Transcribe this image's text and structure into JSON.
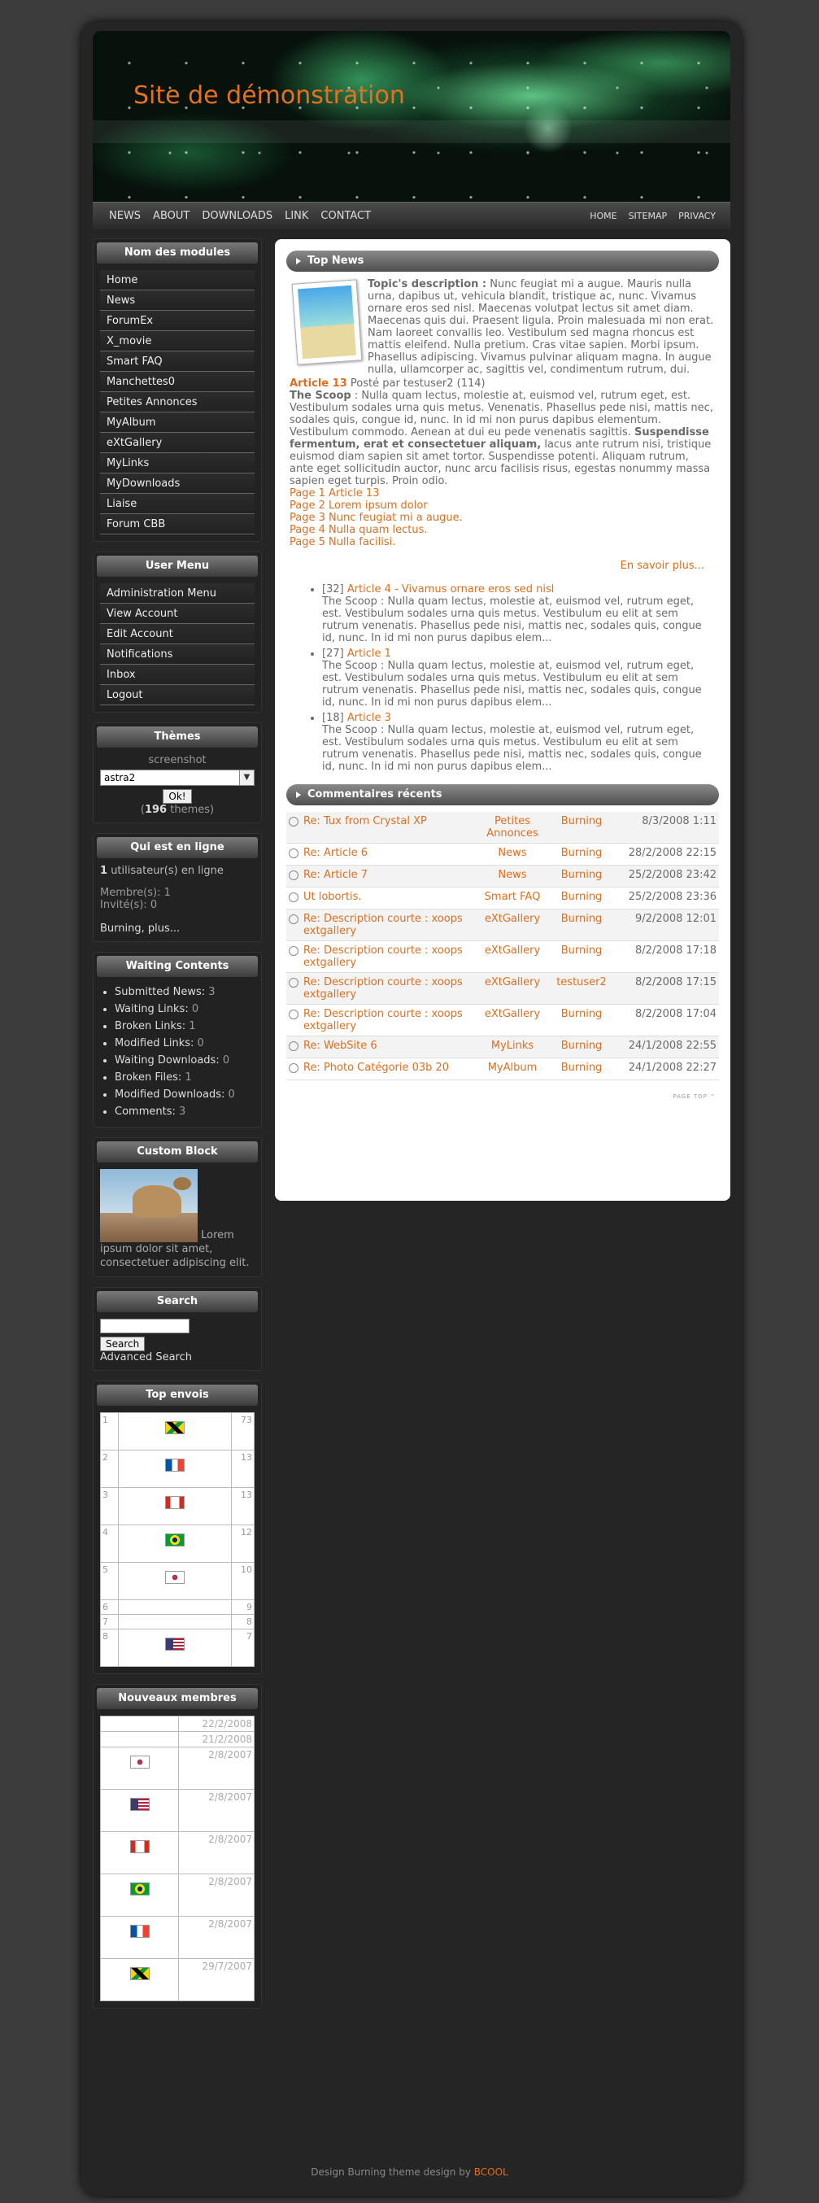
{
  "site_title": "Site de démonstration",
  "nav": {
    "left": [
      "NEWS",
      "ABOUT",
      "DOWNLOADS",
      "LINK",
      "CONTACT"
    ],
    "right": [
      "HOME",
      "SITEMAP",
      "PRIVACY"
    ]
  },
  "modules": {
    "title": "Nom des modules",
    "items": [
      "Home",
      "News",
      "ForumEx",
      "X_movie",
      "Smart FAQ",
      "Manchettes0",
      "Petites Annonces",
      "MyAlbum",
      "eXtGallery",
      "MyLinks",
      "MyDownloads",
      "Liaise",
      "Forum CBB"
    ]
  },
  "user_menu": {
    "title": "User Menu",
    "items": [
      "Administration Menu",
      "View Account",
      "Edit Account",
      "Notifications",
      "Inbox",
      "Logout"
    ]
  },
  "themes": {
    "title": "Thèmes",
    "screenshot": "screenshot",
    "selected": "astra2",
    "ok": "Ok!",
    "count": "196",
    "count_label": "themes"
  },
  "online": {
    "title": "Qui est en ligne",
    "count": "1",
    "count_label": "utilisateur(s) en ligne",
    "members": "Membre(s): 1",
    "guests": "Invité(s): 0",
    "names": "Burning, plus..."
  },
  "waiting": {
    "title": "Waiting Contents",
    "items": [
      {
        "label": "Submitted News:",
        "value": "3"
      },
      {
        "label": "Waiting Links:",
        "value": "0"
      },
      {
        "label": "Broken Links:",
        "value": "1"
      },
      {
        "label": "Modified Links:",
        "value": "0"
      },
      {
        "label": "Waiting Downloads:",
        "value": "0"
      },
      {
        "label": "Broken Files:",
        "value": "1"
      },
      {
        "label": "Modified Downloads:",
        "value": "0"
      },
      {
        "label": "Comments:",
        "value": "3"
      }
    ]
  },
  "custom": {
    "title": "Custom Block",
    "text": "Lorem ipsum dolor sit amet, consectetuer adipiscing elit."
  },
  "search": {
    "title": "Search",
    "button": "Search",
    "advanced": "Advanced Search"
  },
  "top": {
    "title": "Top envois",
    "rows": [
      {
        "rank": "1",
        "flag": "jm",
        "count": "73"
      },
      {
        "rank": "2",
        "flag": "fr",
        "count": "13"
      },
      {
        "rank": "3",
        "flag": "ca",
        "count": "13"
      },
      {
        "rank": "4",
        "flag": "br",
        "count": "12"
      },
      {
        "rank": "5",
        "flag": "kr",
        "count": "10"
      },
      {
        "rank": "6",
        "flag": "",
        "count": "9"
      },
      {
        "rank": "7",
        "flag": "",
        "count": "8"
      },
      {
        "rank": "8",
        "flag": "us",
        "count": "7"
      }
    ]
  },
  "newmembers": {
    "title": "Nouveaux membres",
    "rows": [
      {
        "flag": "",
        "date": "22/2/2008"
      },
      {
        "flag": "",
        "date": "21/2/2008"
      },
      {
        "flag": "kr",
        "date": "2/8/2007"
      },
      {
        "flag": "us",
        "date": "2/8/2007"
      },
      {
        "flag": "ca",
        "date": "2/8/2007"
      },
      {
        "flag": "br",
        "date": "2/8/2007"
      },
      {
        "flag": "fr",
        "date": "2/8/2007"
      },
      {
        "flag": "jm",
        "date": "29/7/2007"
      }
    ]
  },
  "topnews": {
    "title": "Top News",
    "desc_label": "Topic's description :",
    "desc": "Nunc feugiat mi a augue. Mauris nulla urna, dapibus ut, vehicula blandit, tristique ac, nunc. Vivamus ornare eros sed nisl. Maecenas volutpat lectus sit amet diam. Maecenas quis dui. Praesent ligula. Proin malesuada mi non erat. Nam laoreet convallis leo. Vestibulum sed magna rhoncus est mattis eleifend. Nulla pretium. Cras vitae sapien. Morbi ipsum. Phasellus adipiscing. Vivamus pulvinar aliquam magna. In augue nulla, ullamcorper ac, sagittis vel, condimentum rutrum, dui.",
    "article": "Article 13",
    "posted": "Posté par testuser2 (114)",
    "scoop_label": "The Scoop",
    "scoop1": " : Nulla quam lectus, molestie at, euismod vel, rutrum eget, est. Vestibulum sodales urna quis metus. Venenatis. Phasellus pede nisi, mattis nec, sodales quis, congue id, nunc. In id mi non purus dapibus elementum. Vestibulum commodo. Aenean at dui eu pede venenatis sagittis. ",
    "scoop_bold": "Suspendisse fermentum, erat et consectetuer aliquam,",
    "scoop2": " lacus ante rutrum nisi, tristique euismod diam sapien sit amet tortor. Suspendisse potenti. Aliquam rutrum, ante eget sollicitudin auctor, nunc arcu facilisis risus, egestas nonummy massa sapien eget turpis. Proin odio.",
    "pages": [
      "Page 1 Article 13",
      "Page 2 Lorem ipsum dolor",
      "Page 3 Nunc feugiat mi a augue.",
      "Page 4 Nulla quam lectus.",
      "Page 5 Nulla facilisi."
    ],
    "more": "En savoir plus...",
    "list": [
      {
        "count": "[32]",
        "title": "Article 4 - Vivamus ornare eros sed nisl",
        "text": "The Scoop : Nulla quam lectus, molestie at, euismod vel, rutrum eget, est. Vestibulum sodales urna quis metus. Vestibulum eu elit at sem rutrum venenatis. Phasellus pede nisi, mattis nec, sodales quis, congue id, nunc. In id mi non purus dapibus elem..."
      },
      {
        "count": "[27]",
        "title": "Article 1",
        "text": "The Scoop : Nulla quam lectus, molestie at, euismod vel, rutrum eget, est. Vestibulum sodales urna quis metus. Vestibulum eu elit at sem rutrum venenatis. Phasellus pede nisi, mattis nec, sodales quis, congue id, nunc. In id mi non purus dapibus elem..."
      },
      {
        "count": "[18]",
        "title": "Article 3",
        "text": "The Scoop : Nulla quam lectus, molestie at, euismod vel, rutrum eget, est. Vestibulum sodales urna quis metus. Vestibulum eu elit at sem rutrum venenatis. Phasellus pede nisi, mattis nec, sodales quis, congue id, nunc. In id mi non purus dapibus elem..."
      }
    ]
  },
  "comments": {
    "title": "Commentaires récents",
    "rows": [
      {
        "title": "Re: Tux from Crystal XP",
        "module": "Petites Annonces",
        "user": "Burning",
        "date": "8/3/2008 1:11"
      },
      {
        "title": "Re: Article 6",
        "module": "News",
        "user": "Burning",
        "date": "28/2/2008 22:15"
      },
      {
        "title": "Re: Article 7",
        "module": "News",
        "user": "Burning",
        "date": "25/2/2008 23:42"
      },
      {
        "title": "Ut lobortis.",
        "module": "Smart FAQ",
        "user": "Burning",
        "date": "25/2/2008 23:36"
      },
      {
        "title": "Re: Description courte : xoops extgallery",
        "module": "eXtGallery",
        "user": "Burning",
        "date": "9/2/2008 12:01"
      },
      {
        "title": "Re: Description courte : xoops extgallery",
        "module": "eXtGallery",
        "user": "Burning",
        "date": "8/2/2008 17:18"
      },
      {
        "title": "Re: Description courte : xoops extgallery",
        "module": "eXtGallery",
        "user": "testuser2",
        "date": "8/2/2008 17:15"
      },
      {
        "title": "Re: Description courte : xoops extgallery",
        "module": "eXtGallery",
        "user": "Burning",
        "date": "8/2/2008 17:04"
      },
      {
        "title": "Re: WebSite 6",
        "module": "MyLinks",
        "user": "Burning",
        "date": "24/1/2008 22:55"
      },
      {
        "title": "Re: Photo Catégorie 03b 20",
        "module": "MyAlbum",
        "user": "Burning",
        "date": "24/1/2008 22:27"
      }
    ]
  },
  "pagetop": "PAGE TOP",
  "footer": {
    "text": "Design Burning theme design by ",
    "link": "BCOOL"
  }
}
